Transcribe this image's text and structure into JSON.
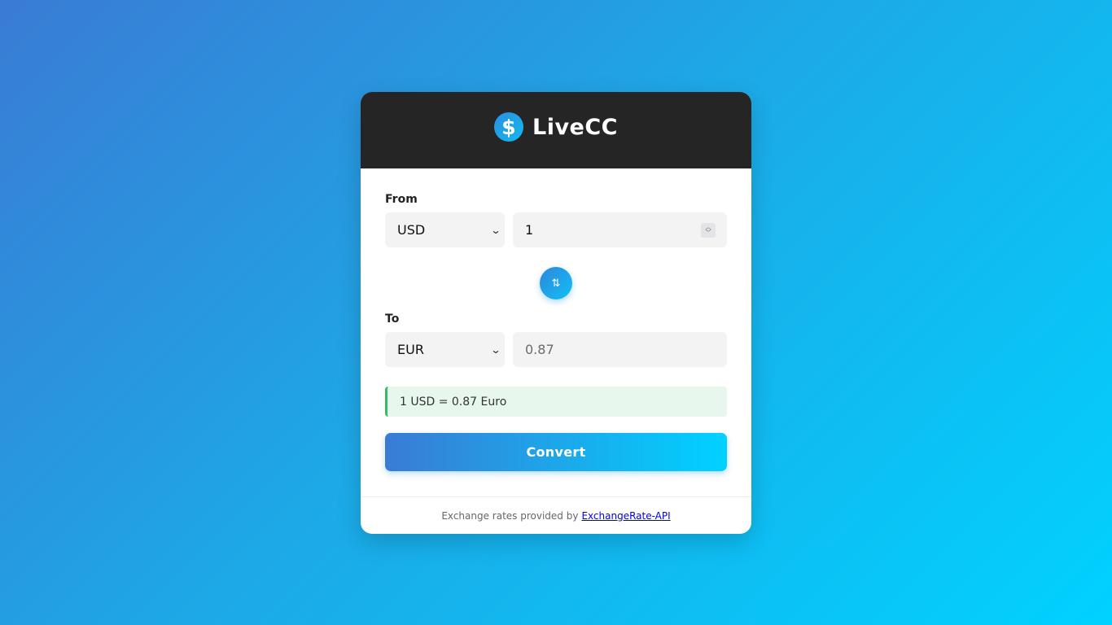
{
  "app": {
    "title": "LiveCC",
    "logo_symbol": "$",
    "logo_icon": "dollar-icon"
  },
  "from": {
    "label": "From",
    "currency": "USD",
    "amount": "1"
  },
  "swap": {
    "symbol": "⇅",
    "icon": "swap-icon"
  },
  "to": {
    "label": "To",
    "currency": "EUR",
    "amount_placeholder": "0.87"
  },
  "rate_text": "1 USD = 0.87 Euro",
  "convert_label": "Convert",
  "footer": {
    "text": "Exchange rates provided by",
    "link_text": "ExchangeRate-API"
  },
  "colors": {
    "background_start": "#3a7bd5",
    "background_end": "#00d2ff",
    "header_bg": "#252525",
    "rate_accent": "#2ebd5f"
  }
}
